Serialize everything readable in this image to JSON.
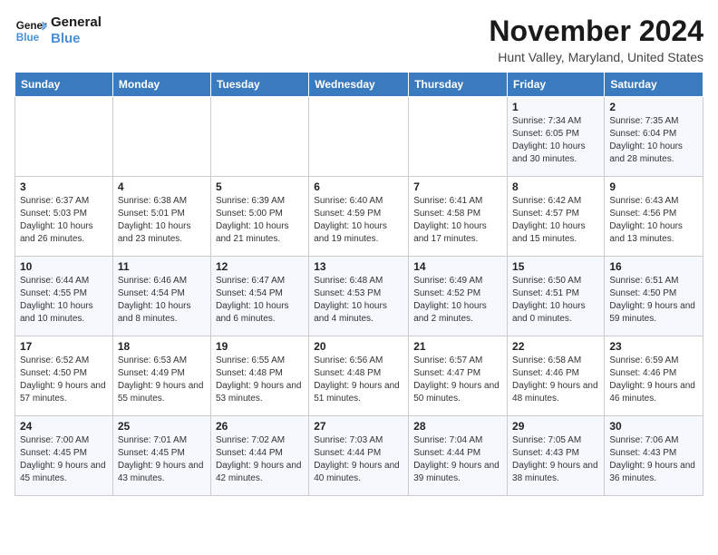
{
  "logo": {
    "line1": "General",
    "line2": "Blue"
  },
  "header": {
    "month": "November 2024",
    "location": "Hunt Valley, Maryland, United States"
  },
  "weekdays": [
    "Sunday",
    "Monday",
    "Tuesday",
    "Wednesday",
    "Thursday",
    "Friday",
    "Saturday"
  ],
  "weeks": [
    [
      {
        "day": "",
        "info": ""
      },
      {
        "day": "",
        "info": ""
      },
      {
        "day": "",
        "info": ""
      },
      {
        "day": "",
        "info": ""
      },
      {
        "day": "",
        "info": ""
      },
      {
        "day": "1",
        "info": "Sunrise: 7:34 AM\nSunset: 6:05 PM\nDaylight: 10 hours and 30 minutes."
      },
      {
        "day": "2",
        "info": "Sunrise: 7:35 AM\nSunset: 6:04 PM\nDaylight: 10 hours and 28 minutes."
      }
    ],
    [
      {
        "day": "3",
        "info": "Sunrise: 6:37 AM\nSunset: 5:03 PM\nDaylight: 10 hours and 26 minutes."
      },
      {
        "day": "4",
        "info": "Sunrise: 6:38 AM\nSunset: 5:01 PM\nDaylight: 10 hours and 23 minutes."
      },
      {
        "day": "5",
        "info": "Sunrise: 6:39 AM\nSunset: 5:00 PM\nDaylight: 10 hours and 21 minutes."
      },
      {
        "day": "6",
        "info": "Sunrise: 6:40 AM\nSunset: 4:59 PM\nDaylight: 10 hours and 19 minutes."
      },
      {
        "day": "7",
        "info": "Sunrise: 6:41 AM\nSunset: 4:58 PM\nDaylight: 10 hours and 17 minutes."
      },
      {
        "day": "8",
        "info": "Sunrise: 6:42 AM\nSunset: 4:57 PM\nDaylight: 10 hours and 15 minutes."
      },
      {
        "day": "9",
        "info": "Sunrise: 6:43 AM\nSunset: 4:56 PM\nDaylight: 10 hours and 13 minutes."
      }
    ],
    [
      {
        "day": "10",
        "info": "Sunrise: 6:44 AM\nSunset: 4:55 PM\nDaylight: 10 hours and 10 minutes."
      },
      {
        "day": "11",
        "info": "Sunrise: 6:46 AM\nSunset: 4:54 PM\nDaylight: 10 hours and 8 minutes."
      },
      {
        "day": "12",
        "info": "Sunrise: 6:47 AM\nSunset: 4:54 PM\nDaylight: 10 hours and 6 minutes."
      },
      {
        "day": "13",
        "info": "Sunrise: 6:48 AM\nSunset: 4:53 PM\nDaylight: 10 hours and 4 minutes."
      },
      {
        "day": "14",
        "info": "Sunrise: 6:49 AM\nSunset: 4:52 PM\nDaylight: 10 hours and 2 minutes."
      },
      {
        "day": "15",
        "info": "Sunrise: 6:50 AM\nSunset: 4:51 PM\nDaylight: 10 hours and 0 minutes."
      },
      {
        "day": "16",
        "info": "Sunrise: 6:51 AM\nSunset: 4:50 PM\nDaylight: 9 hours and 59 minutes."
      }
    ],
    [
      {
        "day": "17",
        "info": "Sunrise: 6:52 AM\nSunset: 4:50 PM\nDaylight: 9 hours and 57 minutes."
      },
      {
        "day": "18",
        "info": "Sunrise: 6:53 AM\nSunset: 4:49 PM\nDaylight: 9 hours and 55 minutes."
      },
      {
        "day": "19",
        "info": "Sunrise: 6:55 AM\nSunset: 4:48 PM\nDaylight: 9 hours and 53 minutes."
      },
      {
        "day": "20",
        "info": "Sunrise: 6:56 AM\nSunset: 4:48 PM\nDaylight: 9 hours and 51 minutes."
      },
      {
        "day": "21",
        "info": "Sunrise: 6:57 AM\nSunset: 4:47 PM\nDaylight: 9 hours and 50 minutes."
      },
      {
        "day": "22",
        "info": "Sunrise: 6:58 AM\nSunset: 4:46 PM\nDaylight: 9 hours and 48 minutes."
      },
      {
        "day": "23",
        "info": "Sunrise: 6:59 AM\nSunset: 4:46 PM\nDaylight: 9 hours and 46 minutes."
      }
    ],
    [
      {
        "day": "24",
        "info": "Sunrise: 7:00 AM\nSunset: 4:45 PM\nDaylight: 9 hours and 45 minutes."
      },
      {
        "day": "25",
        "info": "Sunrise: 7:01 AM\nSunset: 4:45 PM\nDaylight: 9 hours and 43 minutes."
      },
      {
        "day": "26",
        "info": "Sunrise: 7:02 AM\nSunset: 4:44 PM\nDaylight: 9 hours and 42 minutes."
      },
      {
        "day": "27",
        "info": "Sunrise: 7:03 AM\nSunset: 4:44 PM\nDaylight: 9 hours and 40 minutes."
      },
      {
        "day": "28",
        "info": "Sunrise: 7:04 AM\nSunset: 4:44 PM\nDaylight: 9 hours and 39 minutes."
      },
      {
        "day": "29",
        "info": "Sunrise: 7:05 AM\nSunset: 4:43 PM\nDaylight: 9 hours and 38 minutes."
      },
      {
        "day": "30",
        "info": "Sunrise: 7:06 AM\nSunset: 4:43 PM\nDaylight: 9 hours and 36 minutes."
      }
    ]
  ]
}
